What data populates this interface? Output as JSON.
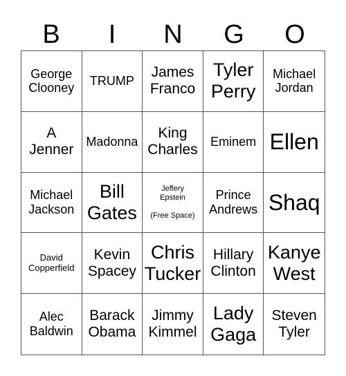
{
  "header": [
    "B",
    "I",
    "N",
    "G",
    "O"
  ],
  "cells": [
    {
      "text": "George Clooney",
      "size": "s-md"
    },
    {
      "text": "TRUMP",
      "size": "s-md"
    },
    {
      "text": "James Franco",
      "size": "s-lg"
    },
    {
      "text": "Tyler Perry",
      "size": "s-xl"
    },
    {
      "text": "Michael Jordan",
      "size": "s-md"
    },
    {
      "text": "A Jenner",
      "size": "s-lg"
    },
    {
      "text": "Madonna",
      "size": "s-md"
    },
    {
      "text": "King Charles",
      "size": "s-lg"
    },
    {
      "text": "Eminem",
      "size": "s-md"
    },
    {
      "text": "Ellen",
      "size": "s-xxl"
    },
    {
      "text": "Michael Jackson",
      "size": "s-md"
    },
    {
      "text": "Bill Gates",
      "size": "s-xl"
    },
    {
      "text": "Jeffery Epstein",
      "sub": "(Free Space)",
      "free": true
    },
    {
      "text": "Prince Andrews",
      "size": "s-md"
    },
    {
      "text": "Shaq",
      "size": "s-xxl"
    },
    {
      "text": "David Copperfield",
      "size": "s-sm"
    },
    {
      "text": "Kevin Spacey",
      "size": "s-lg"
    },
    {
      "text": "Chris Tucker",
      "size": "s-xl"
    },
    {
      "text": "Hillary Clinton",
      "size": "s-lg"
    },
    {
      "text": "Kanye West",
      "size": "s-xl"
    },
    {
      "text": "Alec Baldwin",
      "size": "s-md"
    },
    {
      "text": "Barack Obama",
      "size": "s-lg"
    },
    {
      "text": "Jimmy Kimmel",
      "size": "s-lg"
    },
    {
      "text": "Lady Gaga",
      "size": "s-xl"
    },
    {
      "text": "Steven Tyler",
      "size": "s-lg"
    }
  ]
}
